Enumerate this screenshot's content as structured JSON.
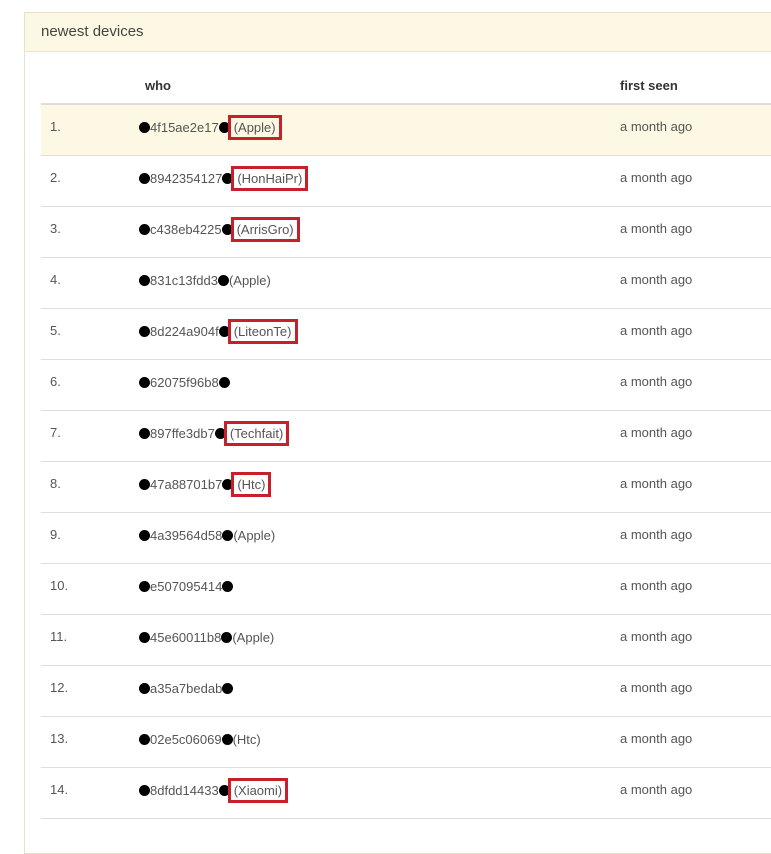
{
  "panel": {
    "title": "newest devices",
    "columns": {
      "who": "who",
      "first_seen": "first seen"
    }
  },
  "rows": [
    {
      "num": "1.",
      "mac": "4f15ae2e17",
      "vendor": "(Apple)",
      "boxed": true,
      "first_seen": "a month ago"
    },
    {
      "num": "2.",
      "mac": "8942354127",
      "vendor": "(HonHaiPr)",
      "boxed": true,
      "first_seen": "a month ago"
    },
    {
      "num": "3.",
      "mac": "c438eb4225",
      "vendor": "(ArrisGro)",
      "boxed": true,
      "first_seen": "a month ago"
    },
    {
      "num": "4.",
      "mac": "831c13fdd3",
      "vendor": "(Apple)",
      "boxed": false,
      "first_seen": "a month ago"
    },
    {
      "num": "5.",
      "mac": "8d224a904f",
      "vendor": "(LiteonTe)",
      "boxed": true,
      "first_seen": "a month ago"
    },
    {
      "num": "6.",
      "mac": "62075f96b8",
      "vendor": "",
      "boxed": false,
      "first_seen": "a month ago"
    },
    {
      "num": "7.",
      "mac": "897ffe3db7",
      "vendor": "(Techfait)",
      "boxed": true,
      "first_seen": "a month ago"
    },
    {
      "num": "8.",
      "mac": "47a88701b7",
      "vendor": "(Htc)",
      "boxed": true,
      "first_seen": "a month ago"
    },
    {
      "num": "9.",
      "mac": "4a39564d58",
      "vendor": "(Apple)",
      "boxed": false,
      "first_seen": "a month ago"
    },
    {
      "num": "10.",
      "mac": "e507095414",
      "vendor": "",
      "boxed": false,
      "first_seen": "a month ago"
    },
    {
      "num": "11.",
      "mac": "45e60011b8",
      "vendor": "(Apple)",
      "boxed": false,
      "first_seen": "a month ago"
    },
    {
      "num": "12.",
      "mac": "a35a7bedab",
      "vendor": "",
      "boxed": false,
      "first_seen": "a month ago"
    },
    {
      "num": "13.",
      "mac": "02e5c06069",
      "vendor": "(Htc)",
      "boxed": false,
      "first_seen": "a month ago"
    },
    {
      "num": "14.",
      "mac": "8dfdd14433",
      "vendor": "(Xiaomi)",
      "boxed": true,
      "first_seen": "a month ago"
    }
  ],
  "colors": {
    "header_bg": "#fcf8e3",
    "highlight_box": "#c8202a",
    "redaction_dot": "#000000"
  },
  "icons": {
    "redaction": "redaction-dot"
  }
}
